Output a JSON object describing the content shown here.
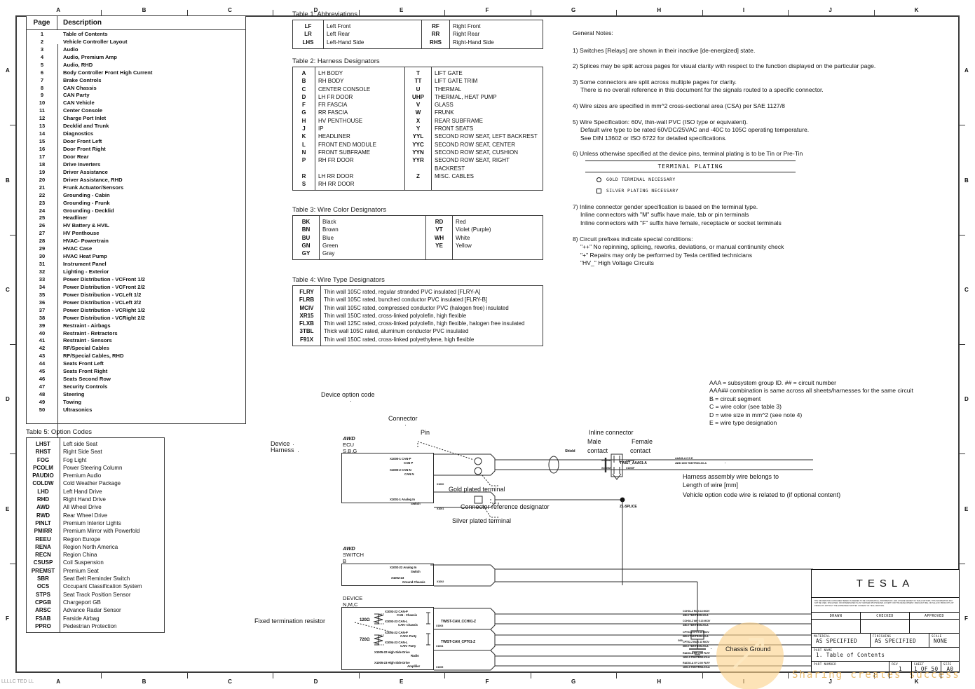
{
  "sheet": {
    "ruler_top": [
      "A",
      "B",
      "C",
      "D",
      "E",
      "F",
      "G",
      "H",
      "I",
      "J",
      "K"
    ],
    "ruler_bottom": [
      "A",
      "B",
      "C",
      "D",
      "E",
      "F",
      "G",
      "H",
      "I",
      "J",
      "K"
    ],
    "ruler_left": [
      "A",
      "B",
      "C",
      "D",
      "E",
      "F"
    ],
    "ruler_right": [
      "A",
      "B",
      "C",
      "D",
      "E",
      "F"
    ]
  },
  "toc": {
    "header": {
      "page": "Page",
      "description": "Description"
    },
    "rows": [
      {
        "page": "1",
        "description": "Table of Contents"
      },
      {
        "page": "2",
        "description": "Vehicle Controller Layout"
      },
      {
        "page": "3",
        "description": "Audio"
      },
      {
        "page": "4",
        "description": "Audio, Premium Amp"
      },
      {
        "page": "5",
        "description": "Audio, RHD"
      },
      {
        "page": "6",
        "description": "Body Controller Front High Current"
      },
      {
        "page": "7",
        "description": "Brake Controls"
      },
      {
        "page": "8",
        "description": "CAN Chassis"
      },
      {
        "page": "9",
        "description": "CAN Party"
      },
      {
        "page": "10",
        "description": "CAN Vehicle"
      },
      {
        "page": "11",
        "description": "Center Console"
      },
      {
        "page": "12",
        "description": "Charge Port Inlet"
      },
      {
        "page": "13",
        "description": "Decklid and Trunk"
      },
      {
        "page": "14",
        "description": "Diagnostics"
      },
      {
        "page": "15",
        "description": "Door Front Left"
      },
      {
        "page": "16",
        "description": "Door Front Right"
      },
      {
        "page": "17",
        "description": "Door Rear"
      },
      {
        "page": "18",
        "description": "Drive Inverters"
      },
      {
        "page": "19",
        "description": "Driver Assistance"
      },
      {
        "page": "20",
        "description": "Driver Assistance, RHD"
      },
      {
        "page": "21",
        "description": "Frunk Actuator/Sensors"
      },
      {
        "page": "22",
        "description": "Grounding - Cabin"
      },
      {
        "page": "23",
        "description": "Grounding - Frunk"
      },
      {
        "page": "24",
        "description": "Grounding - Decklid"
      },
      {
        "page": "25",
        "description": "Headliner"
      },
      {
        "page": "26",
        "description": "HV Battery & HVIL"
      },
      {
        "page": "27",
        "description": "HV Penthouse"
      },
      {
        "page": "28",
        "description": "HVAC- Powertrain"
      },
      {
        "page": "29",
        "description": "HVAC Case"
      },
      {
        "page": "30",
        "description": "HVAC Heat Pump"
      },
      {
        "page": "31",
        "description": "Instrument Panel"
      },
      {
        "page": "32",
        "description": "Lighting - Exterior"
      },
      {
        "page": "33",
        "description": "Power Distribution - VCFront 1/2"
      },
      {
        "page": "34",
        "description": "Power Distribution - VCFront 2/2"
      },
      {
        "page": "35",
        "description": "Power Distribution - VCLeft 1/2"
      },
      {
        "page": "36",
        "description": "Power Distribution - VCLeft 2/2"
      },
      {
        "page": "37",
        "description": "Power Distribution - VCRight 1/2"
      },
      {
        "page": "38",
        "description": "Power Distribution - VCRight 2/2"
      },
      {
        "page": "39",
        "description": "Restraint - Airbags"
      },
      {
        "page": "40",
        "description": "Restraint - Retractors"
      },
      {
        "page": "41",
        "description": "Restraint - Sensors"
      },
      {
        "page": "42",
        "description": "RF/Special Cables"
      },
      {
        "page": "43",
        "description": "RF/Special Cables, RHD"
      },
      {
        "page": "44",
        "description": "Seats Front Left"
      },
      {
        "page": "45",
        "description": "Seats Front Right"
      },
      {
        "page": "46",
        "description": "Seats Second Row"
      },
      {
        "page": "47",
        "description": "Security Controls"
      },
      {
        "page": "48",
        "description": "Steering"
      },
      {
        "page": "49",
        "description": "Towing"
      },
      {
        "page": "50",
        "description": "Ultrasonics"
      }
    ]
  },
  "table1": {
    "caption": "Table 1: Abbreviations",
    "rows": [
      {
        "c1": "LF",
        "d1": "Left Front",
        "c2": "RF",
        "d2": "Right Front"
      },
      {
        "c1": "LR",
        "d1": "Left Rear",
        "c2": "RR",
        "d2": "Right Rear"
      },
      {
        "c1": "LHS",
        "d1": "Left-Hand Side",
        "c2": "RHS",
        "d2": "Right-Hand Side"
      }
    ]
  },
  "table2": {
    "caption": "Table 2: Harness Designators",
    "rows": [
      {
        "c1": "A",
        "d1": "LH BODY",
        "c2": "T",
        "d2": "LIFT GATE"
      },
      {
        "c1": "B",
        "d1": "RH BODY",
        "c2": "TT",
        "d2": "LIFT GATE TRIM"
      },
      {
        "c1": "C",
        "d1": "CENTER CONSOLE",
        "c2": "U",
        "d2": "THERMAL"
      },
      {
        "c1": "D",
        "d1": "LH FR DOOR",
        "c2": "UHP",
        "d2": "THERMAL, HEAT PUMP"
      },
      {
        "c1": "F",
        "d1": "FR FASCIA",
        "c2": "V",
        "d2": "GLASS"
      },
      {
        "c1": "G",
        "d1": "RR FASCIA",
        "c2": "W",
        "d2": "FRUNK"
      },
      {
        "c1": "H",
        "d1": "HV PENTHOUSE",
        "c2": "X",
        "d2": "REAR SUBFRAME"
      },
      {
        "c1": "J",
        "d1": "IP",
        "c2": "Y",
        "d2": "FRONT SEATS"
      },
      {
        "c1": "K",
        "d1": "HEADLINER",
        "c2": "YYL",
        "d2": "SECOND ROW SEAT, LEFT BACKREST"
      },
      {
        "c1": "L",
        "d1": "FRONT END MODULE",
        "c2": "YYC",
        "d2": "SECOND ROW SEAT, CENTER"
      },
      {
        "c1": "N",
        "d1": "FRONT SUBFRAME",
        "c2": "YYN",
        "d2": "SECOND ROW SEAT, CUSHION"
      },
      {
        "c1": "P",
        "d1": "RH FR DOOR",
        "c2": "YYR",
        "d2": "SECOND ROW SEAT, RIGHT BACKREST"
      },
      {
        "c1": "R",
        "d1": "LH RR DOOR",
        "c2": "Z",
        "d2": "MISC. CABLES"
      },
      {
        "c1": "S",
        "d1": "RH RR DOOR",
        "c2": "",
        "d2": ""
      }
    ]
  },
  "table3": {
    "caption": "Table 3: Wire Color Designators",
    "rows": [
      {
        "c1": "BK",
        "d1": "Black",
        "c2": "RD",
        "d2": "Red"
      },
      {
        "c1": "BN",
        "d1": "Brown",
        "c2": "VT",
        "d2": "Violet (Purple)"
      },
      {
        "c1": "BU",
        "d1": "Blue",
        "c2": "WH",
        "d2": "White"
      },
      {
        "c1": "GN",
        "d1": "Green",
        "c2": "YE",
        "d2": "Yellow"
      },
      {
        "c1": "GY",
        "d1": "Gray",
        "c2": "",
        "d2": ""
      }
    ]
  },
  "table4": {
    "caption": "Table 4: Wire Type Designators",
    "rows": [
      {
        "code": "FLRY",
        "desc": "Thin wall 105C rated, regular stranded PVC insulated [FLRY-A]"
      },
      {
        "code": "FLRB",
        "desc": "Thin wall 105C rated, bunched conductor PVC insulated [FLRY-B]"
      },
      {
        "code": "MCIV",
        "desc": "Thin wall 105C rated, compressed conductor PVC (halogen free) insulated"
      },
      {
        "code": "XR15",
        "desc": "Thin wall 150C rated, cross-linked polyolefin, high flexible"
      },
      {
        "code": "FLXB",
        "desc": "Thin wall 125C rated, cross-linked polyolefin, high flexible, halogen free insulated"
      },
      {
        "code": "3TBL",
        "desc": "Thick wall 105C rated, aluminum conductor PVC insulated"
      },
      {
        "code": "F91X",
        "desc": "Thin wall 150C rated, cross-linked polyethylene, high flexible"
      }
    ]
  },
  "table5": {
    "caption": "Table 5: Option Codes",
    "rows": [
      {
        "code": "LHST",
        "desc": "Left side Seat"
      },
      {
        "code": "RHST",
        "desc": "Right Side Seat"
      },
      {
        "code": "FOG",
        "desc": "Fog Light"
      },
      {
        "code": "PCOLM",
        "desc": "Power Steering Column"
      },
      {
        "code": "PAUDIO",
        "desc": "Premium Audio"
      },
      {
        "code": "COLDW",
        "desc": "Cold Weather Package"
      },
      {
        "code": "LHD",
        "desc": "Left Hand Drive"
      },
      {
        "code": "RHD",
        "desc": "Right Hand Drive"
      },
      {
        "code": "AWD",
        "desc": "All Wheel Drive"
      },
      {
        "code": "RWD",
        "desc": "Rear Wheel Drive"
      },
      {
        "code": "PINLT",
        "desc": "Premium Interior Lights"
      },
      {
        "code": "PMIRR",
        "desc": "Premium Mirror with Powerfold"
      },
      {
        "code": "REEU",
        "desc": "Region Europe"
      },
      {
        "code": "RENA",
        "desc": "Region North America"
      },
      {
        "code": "RECN",
        "desc": "Region China"
      },
      {
        "code": "CSUSP",
        "desc": "Coil Suspension"
      },
      {
        "code": "PREMST",
        "desc": "Premium Seat"
      },
      {
        "code": "SBR",
        "desc": "Seat Belt Reminder Switch"
      },
      {
        "code": "OCS",
        "desc": "Occupant Classification System"
      },
      {
        "code": "STPS",
        "desc": "Seat Track Position Sensor"
      },
      {
        "code": "CPGB",
        "desc": "Chargeport GB"
      },
      {
        "code": "ARSC",
        "desc": "Advance Radar Sensor"
      },
      {
        "code": "FSAB",
        "desc": "Farside Airbag"
      },
      {
        "code": "PPRO",
        "desc": "Pedestrian Protection"
      }
    ]
  },
  "notes": {
    "heading": "General Notes:",
    "n1": "1) Switches [Relays] are shown in their inactive [de-energized] state.",
    "n2": "2) Splices may be split across pages for visual clarity with respect to the function displayed on the particular page.",
    "n3a": "3) Some connectors are split across multiple pages for clarity.",
    "n3b": "There is no overall reference in this document for the signals routed to a specific connector.",
    "n4": "4) Wire sizes are specified in mm^2 cross-sectional area (CSA) per SAE 1127/8",
    "n5a": "5) Wire Specification: 60V, thin-wall PVC (ISO type or equivalent).",
    "n5b": "Default wire type to be rated 60VDC/25VAC and -40C to 105C operating temperature.",
    "n5c": "See DIN 13602 or ISO 6722 for detailed specifications.",
    "n6": "6) Unless otherwise specified at the device pins, terminal plating is to be Tin or Pre-Tin",
    "plating_title": "TERMINAL  PLATING",
    "plating_gold": "GOLD TERMINAL NECESSARY",
    "plating_silver": "SILVER PLATING NECESSARY",
    "n7a": "7) Inline connector gender specification is based on the terminal type.",
    "n7b": "Inline connectors with \"M\" suffix have male, tab or pin terminals",
    "n7c": "Inline connectors with \"F\" suffix have female, receptacle or socket terminals",
    "n8a": "8) Circuit prefixes indicate special conditions:",
    "n8b": "\"++\"  No repinning, splicing, reworks, deviations, or manual continunity check",
    "n8c": "\"+\"    Repairs may only be performed by Tesla certified technicians",
    "n8d": "\"HV_\" High Voltage Circuits"
  },
  "wire_legend": {
    "l1": "AAA = subsystem group ID. ## = circuit number",
    "l2": "AAA## combination is same across all sheets/harnesses for the same circuit",
    "l3": "B = circuit segment",
    "l4": "C = wire color (see table 3)",
    "l5": "D = wire size in mm^2 (see note 4)",
    "l6": "E = wire type designation"
  },
  "diagram": {
    "callouts": {
      "device_option_code": "Device option code",
      "connector": "Connector",
      "pin": "Pin",
      "device": "Device",
      "harness": "Harness",
      "gold_plated": "Gold plated terminal",
      "silver_plated": "Silver plated terminal",
      "conn_ref_designator": "Connector reference designator",
      "inline_connector": "Inline connector",
      "male_contact_1": "Male",
      "male_contact_2": "contact",
      "female_contact_1": "Female",
      "female_contact_2": "contact",
      "harness_assembly": "Harness assembly wire belongs to",
      "length_of_wire": "Length of wire [mm]",
      "vehicle_option": "Vehicle option code wire is related to (if optional content)",
      "fixed_resistor": "Fixed termination resistor",
      "chassis_ground": "Chassis Ground",
      "shield": "Shield",
      "twist_aaa01": "TWIST_AAA01-A",
      "splice": "Z1-SPLICE"
    },
    "ecu": {
      "opt": "AWD",
      "name": "ECU",
      "harness": "S,B,G",
      "pins": [
        {
          "ref": "X1000-1 CAN-P",
          "sig": "CAN P"
        },
        {
          "ref": "X1000-2 CAN-N",
          "sig": "CAN N"
        },
        {
          "ref": "X1001-1 Analog In",
          "sig": "Switch"
        }
      ],
      "conn_tags": [
        "X1000",
        "X1001"
      ]
    },
    "switch": {
      "opt": "AWD",
      "name": "SWITCH",
      "harness": "B",
      "pins": [
        {
          "ref": "X1002-22 Analog In",
          "sig": "Switch"
        },
        {
          "ref": "X1002-23",
          "sig": "Ground Chassis"
        }
      ],
      "conn_tags": [
        "X1002"
      ]
    },
    "device": {
      "name": "DEVICE",
      "harness": "N,M,C",
      "resistors": [
        "120Ω",
        "720Ω"
      ],
      "pins": [
        {
          "ref": "X1003-22 CAN-P",
          "sig": "CAN - Chassis"
        },
        {
          "ref": "X1003-23 CAN-L",
          "sig": "CAN- Chassis"
        },
        {
          "ref": "X1004-22 CAN-P",
          "sig": "CAN+ Party"
        },
        {
          "ref": "X1004-23 CAN-L",
          "sig": "CAN- Party"
        },
        {
          "ref": "X1005-22 High-Side Drive",
          "sig": "Radio"
        },
        {
          "ref": "X1005-23 High-Side Drive",
          "sig": "Amplifier"
        }
      ],
      "conn_tags": [
        "X1003",
        "X1004",
        "X1005"
      ],
      "twists": [
        "TWIST-CAN_CCH01-Z",
        "TWIST-CAN_CPT01-Z"
      ],
      "wires": [
        {
          "top": "CCH01-Z    RD   0.13   MCIV",
          "bot": "436.0    TDE/TRSS-XX-A"
        },
        {
          "top": "CCH02-Z    WH   0.13   MCIV",
          "bot": "436.0    TDE/TRSS-XX-A"
        },
        {
          "top": "CPT01-Z    GY   0.13   MCIV",
          "bot": "660.0    TDE/TRSS-XX-A"
        },
        {
          "top": "CPT02-Z    BU   0.13   MCIV",
          "bot": "660.0    TDE/TRSS-XX-A"
        },
        {
          "top": "RAD01-A    BK   2.00   FLRY",
          "bot": "1691.0   TDE/TRSS-XX-A"
        },
        {
          "top": "RAD02-A    GY   2.00   FLRY",
          "bot": "1691.0   TDE/TRSS-XX-A"
        }
      ]
    },
    "inline": {
      "male_tags": [
        "X1000M",
        "X1000M"
      ],
      "female_tags": [
        "X1000F",
        "X1000F"
      ],
      "wire_top": "AAA01-A    C    D    E",
      "wire_bot": "AWD     1000    TDE/TRSS-XX-A"
    },
    "ground_tag": "G00"
  },
  "titleblock": {
    "logo": "TESLA",
    "legal": "THE INFORMATION CONTAINED HEREIN IS DEEMED TO BE CONFIDENTIAL, PROPRIETARY, AND A TRADE SECRET OF TESLA MOTORS. THIS INFORMATION MAY NOT BE USED, DISCLOSED, OR DISSEMINATED IN ANY MANNER WHATSOEVER, EXCEPT FOR THE DEVELOPMENT, MANUFACTURE, OR SALE OF PRODUCTS, BY PRODUCTS WITHOUT THE EXPRESSED WRITTEN CONSENT OF TESLA MOTORS.",
    "drawn_label": "DRAWN",
    "checked_label": "CHECKED",
    "approved_label": "APPROVED",
    "drawn_value": "",
    "checked_value": "",
    "approved_value": "",
    "material_label": "MATERIAL",
    "material_value": "AS SPECIFIED",
    "finishing_label": "FINISHING",
    "finishing_value": "AS SPECIFIED",
    "scale_label": "SCALE",
    "scale_value": "NONE",
    "part_name_label": "PART NAME",
    "part_name_value": "1. Table of Contents",
    "part_number_label": "PART NUMBER",
    "part_number_value": "",
    "rev_label": "REV",
    "rev_value": "1",
    "sheet_label": "SHEET",
    "sheet_value": "1  OF  50",
    "size_label": "SIZE",
    "size_value": "A0"
  },
  "watermark": {
    "text": "Sharing creates success",
    "corner": "LLLLC TED LL"
  }
}
